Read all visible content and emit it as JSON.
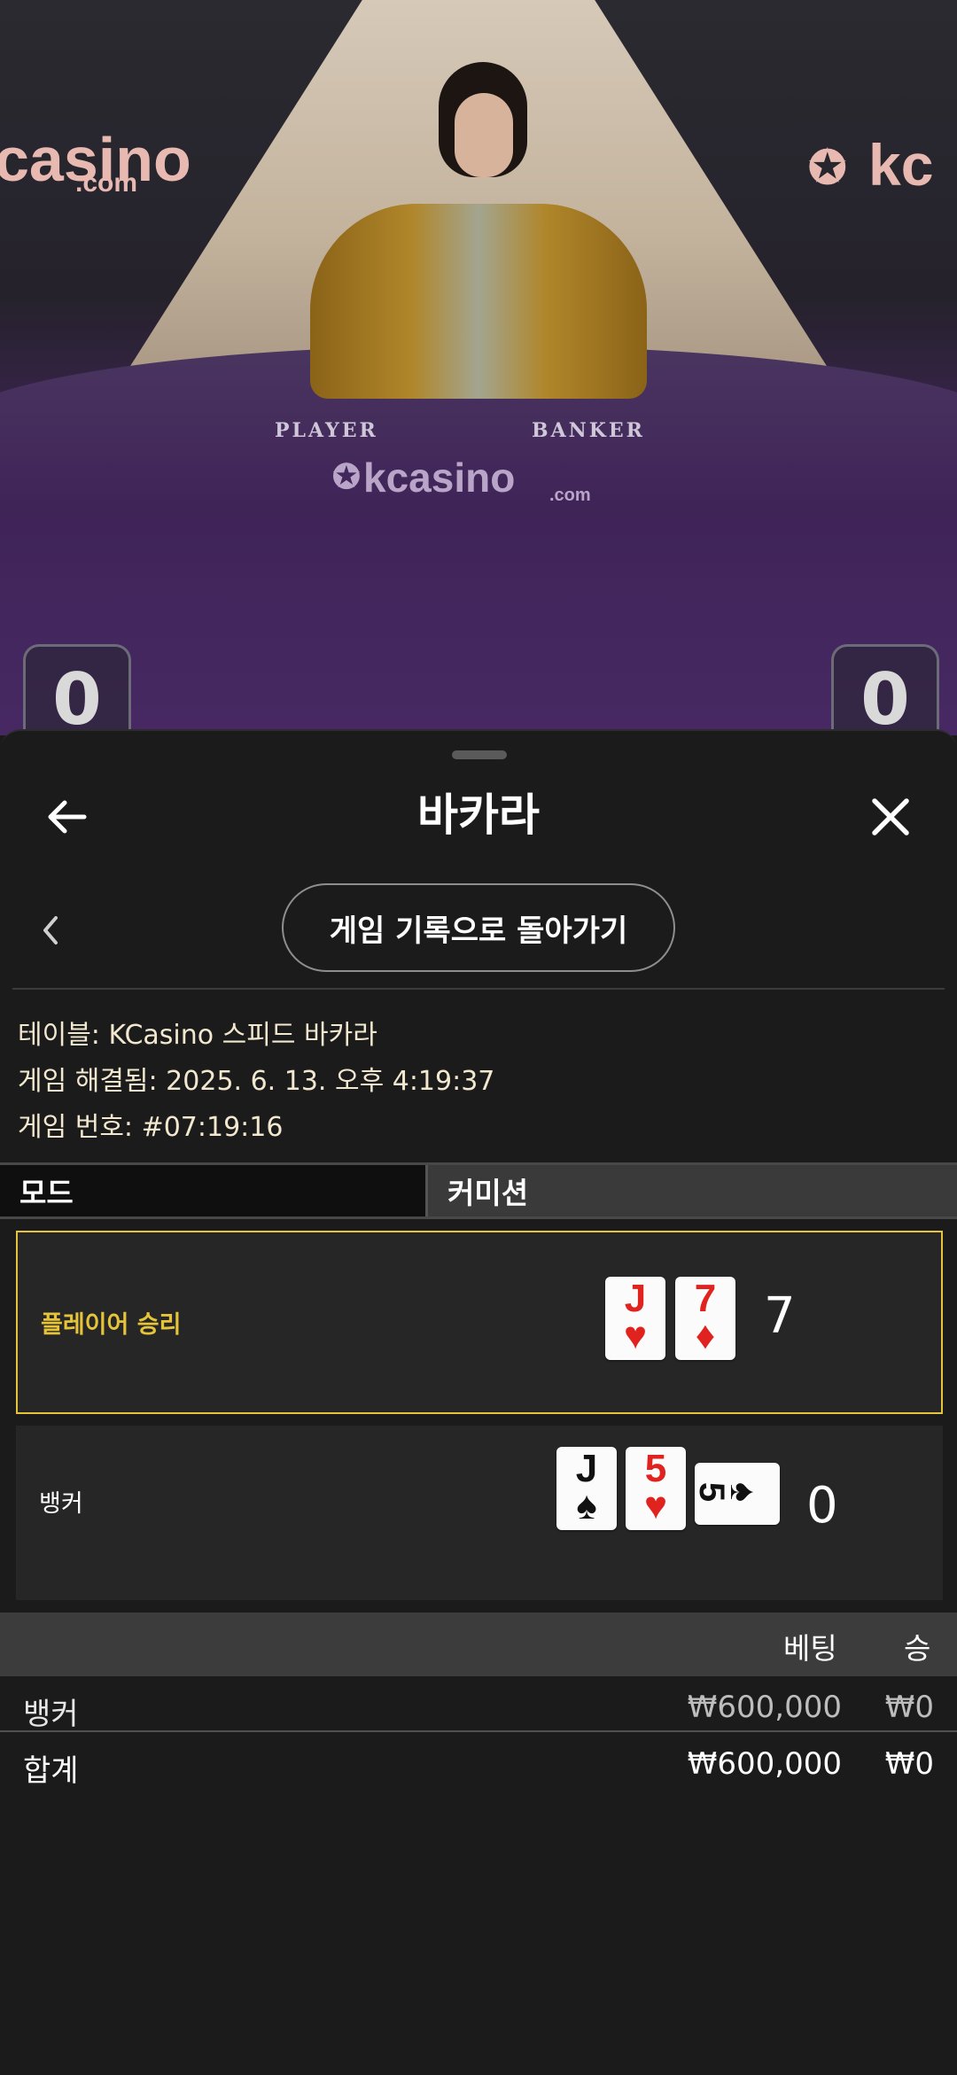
{
  "video": {
    "logo_left": "casino",
    "logo_left_sub": ".com",
    "logo_right": "kc",
    "felt_player": "PLAYER",
    "felt_banker": "BANKER",
    "felt_logo": "kcasino",
    "felt_logo_sub": ".com",
    "player_score": "0",
    "banker_score": "0"
  },
  "sheet": {
    "title": "바카라",
    "back_to_history": "게임 기록으로 돌아가기"
  },
  "info": {
    "table": "테이블: KCasino 스피드 바카라",
    "resolved": "게임 해결됨: 2025. 6. 13. 오후 4:19:37",
    "round": "게임 번호: #07:19:16"
  },
  "tabs": {
    "mode": "모드",
    "commission": "커미션"
  },
  "hands": {
    "player": {
      "label": "플레이어 승리",
      "score": "7",
      "cards": [
        {
          "rank": "J",
          "suit": "♥",
          "color": "#e0231f"
        },
        {
          "rank": "7",
          "suit": "♦",
          "color": "#e0231f"
        }
      ]
    },
    "banker": {
      "label": "뱅커",
      "score": "0",
      "cards": [
        {
          "rank": "J",
          "suit": "♠",
          "color": "#111111"
        },
        {
          "rank": "5",
          "suit": "♥",
          "color": "#e0231f"
        },
        {
          "rank": "5",
          "suit": "♠",
          "color": "#111111",
          "rotated": true
        }
      ]
    }
  },
  "bets": {
    "headers": {
      "bet": "베팅",
      "win": "승"
    },
    "rows": [
      {
        "name": "뱅커",
        "bet": "₩600,000",
        "win": "₩0"
      },
      {
        "name": "합계",
        "bet": "₩600,000",
        "win": "₩0"
      }
    ]
  },
  "colors": {
    "winner_border": "#e5c43a",
    "winner_label": "#e5c43a"
  }
}
